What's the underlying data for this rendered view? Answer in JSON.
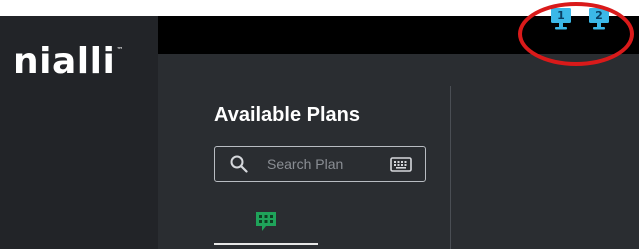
{
  "app": {
    "logo": "nialli",
    "trademark": "™"
  },
  "topbar": {
    "monitors": [
      {
        "label": "1",
        "icon": "monitor-icon"
      },
      {
        "label": "2",
        "icon": "monitor-icon"
      }
    ],
    "highlight_color": "#d91a1a",
    "monitor_color": "#3bb8e8"
  },
  "plans": {
    "title": "Available Plans",
    "search": {
      "placeholder": "Search Plan",
      "value": "",
      "icon": "search-icon",
      "keyboard_icon": "keyboard-icon"
    },
    "tabs": [
      {
        "icon": "grid-chat-icon",
        "active": true,
        "color": "#1fa35a"
      }
    ]
  },
  "colors": {
    "sidebar": "#222428",
    "main": "#2a2d31",
    "topbar": "#000000"
  }
}
